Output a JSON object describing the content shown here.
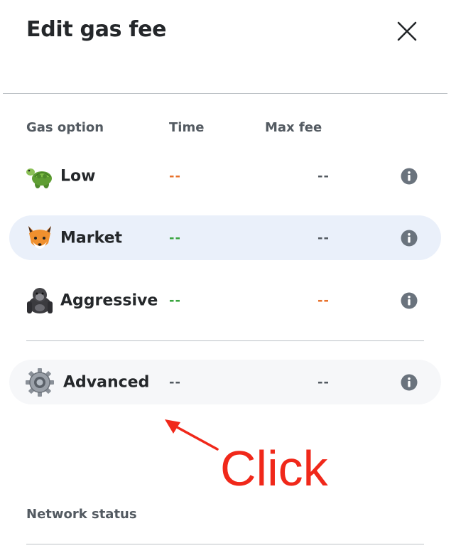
{
  "header": {
    "title": "Edit gas fee",
    "close_icon": "close-icon"
  },
  "columns": {
    "option": "Gas option",
    "time": "Time",
    "max_fee": "Max fee"
  },
  "rows": [
    {
      "name": "Low",
      "icon": "turtle-icon",
      "time": "--",
      "max_fee": "--",
      "time_color": "#e8722c",
      "max_fee_color": "#535a61",
      "selected": false
    },
    {
      "name": "Market",
      "icon": "fox-icon",
      "time": "--",
      "max_fee": "--",
      "time_color": "#3aa53f",
      "max_fee_color": "#535a61",
      "selected": true
    },
    {
      "name": "Aggressive",
      "icon": "gorilla-icon",
      "time": "--",
      "max_fee": "--",
      "time_color": "#3aa53f",
      "max_fee_color": "#e8722c",
      "selected": false
    },
    {
      "name": "Advanced",
      "icon": "gear-icon",
      "time": "--",
      "max_fee": "--",
      "time_color": "#535a61",
      "max_fee_color": "#535a61",
      "selected": false
    }
  ],
  "annotation": {
    "text": "Click",
    "color": "#f0281a"
  },
  "network_status": {
    "label": "Network status"
  },
  "colors": {
    "selected_row_bg": "#eaf0fa",
    "advanced_row_bg": "#f6f7f9",
    "divider": "#bbc0c5",
    "info_icon": "#6a737d"
  }
}
